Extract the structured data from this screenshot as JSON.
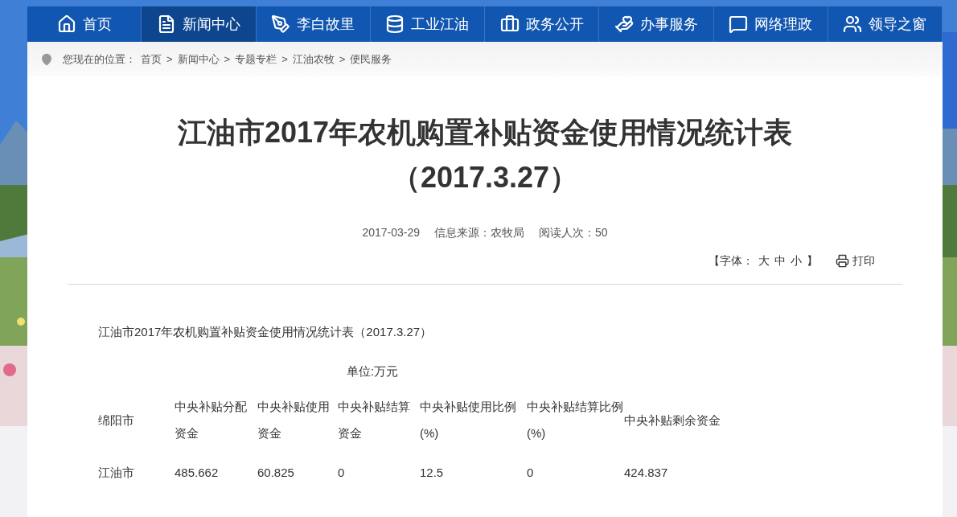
{
  "nav": [
    {
      "label": "首页",
      "selected": false
    },
    {
      "label": "新闻中心",
      "selected": true
    },
    {
      "label": "李白故里",
      "selected": false
    },
    {
      "label": "工业江油",
      "selected": false
    },
    {
      "label": "政务公开",
      "selected": false
    },
    {
      "label": "办事服务",
      "selected": false
    },
    {
      "label": "网络理政",
      "selected": false
    },
    {
      "label": "领导之窗",
      "selected": false
    }
  ],
  "breadcrumb": {
    "prefix": "您现在的位置：",
    "items": [
      "首页",
      "新闻中心",
      "专题专栏",
      "江油农牧",
      "便民服务"
    ],
    "separator": ">"
  },
  "article": {
    "title": "江油市2017年农机购置补贴资金使用情况统计表",
    "subtitle": "（2017.3.27）",
    "meta": [
      "2017-03-29",
      "信息来源：农牧局",
      "阅读人次：50"
    ],
    "font_size": {
      "prefix": "【字体：",
      "options": [
        "大",
        "中",
        "小"
      ],
      "suffix": "】"
    },
    "print": "打印",
    "body_title": "江油市2017年农机购置补贴资金使用情况统计表（2017.3.27）",
    "unit": "单位:万元",
    "table": {
      "columns": [
        "绵阳市",
        "中央补贴分配资金",
        "中央补贴使用资金",
        "中央补贴结算资金",
        "中央补贴使用比例(%)",
        "中央补贴结算比例(%)",
        "中央补贴剩余资金"
      ],
      "rows": [
        [
          "江油市",
          "485.662",
          "60.825",
          "0",
          "12.5",
          "0",
          "424.837"
        ]
      ]
    }
  }
}
